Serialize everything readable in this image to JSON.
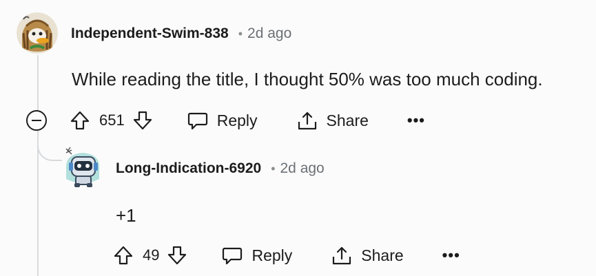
{
  "comments": [
    {
      "username": "Independent-Swim-838",
      "separator": "•",
      "time": "2d ago",
      "body": "While reading the title, I thought 50% was too much coding.",
      "score": "651",
      "reply_label": "Reply",
      "share_label": "Share",
      "more_label": "•••"
    },
    {
      "username": "Long-Indication-6920",
      "separator": "•",
      "time": "2d ago",
      "body": "+1",
      "score": "49",
      "reply_label": "Reply",
      "share_label": "Share",
      "more_label": "•••"
    }
  ],
  "icons": {
    "collapse": "collapse-minus-icon",
    "upvote": "arrow-up-icon",
    "downvote": "arrow-down-icon",
    "reply": "speech-bubble-icon",
    "share": "share-icon",
    "more": "ellipsis-icon"
  }
}
